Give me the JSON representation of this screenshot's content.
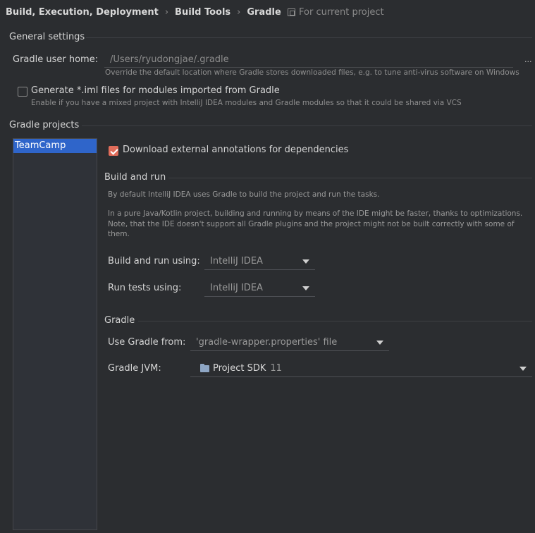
{
  "breadcrumb": {
    "items": [
      "Build, Execution, Deployment",
      "Build Tools",
      "Gradle"
    ],
    "separator": "›",
    "scope_label": "For current project"
  },
  "general": {
    "title": "General settings",
    "user_home_label": "Gradle user home:",
    "user_home_value": "/Users/ryudongjae/.gradle",
    "browse_label": "...",
    "user_home_hint": "Override the default location where Gradle stores downloaded files, e.g. to tune anti-virus software on Windows",
    "iml_label": "Generate *.iml files for modules imported from Gradle",
    "iml_checked": false,
    "iml_hint": "Enable if you have a mixed project with IntelliJ IDEA modules and Gradle modules so that it could be shared via VCS"
  },
  "projects": {
    "title": "Gradle projects",
    "items": [
      "TeamCamp"
    ],
    "selected_index": 0
  },
  "annotations": {
    "label": "Download external annotations for dependencies",
    "checked": true
  },
  "build_run": {
    "title": "Build and run",
    "desc1": "By default IntelliJ IDEA uses Gradle to build the project and run the tasks.",
    "desc2_line1": "In a pure Java/Kotlin project, building and running by means of the IDE might be faster, thanks to optimizations.",
    "desc2_line2": "Note, that the IDE doesn't support all Gradle plugins and the project might not be built correctly with some of",
    "desc2_line3": "them.",
    "build_using_label": "Build and run using:",
    "build_using_value": "IntelliJ IDEA",
    "tests_using_label": "Run tests using:",
    "tests_using_value": "IntelliJ IDEA"
  },
  "gradle": {
    "title": "Gradle",
    "use_from_label": "Use Gradle from:",
    "use_from_value": "'gradle-wrapper.properties' file",
    "jvm_label": "Gradle JVM:",
    "jvm_value": "Project SDK",
    "jvm_version": "11"
  },
  "colors": {
    "background": "#2b2d30",
    "selection": "#2f65ca",
    "checkbox_on": "#e06c5a"
  }
}
